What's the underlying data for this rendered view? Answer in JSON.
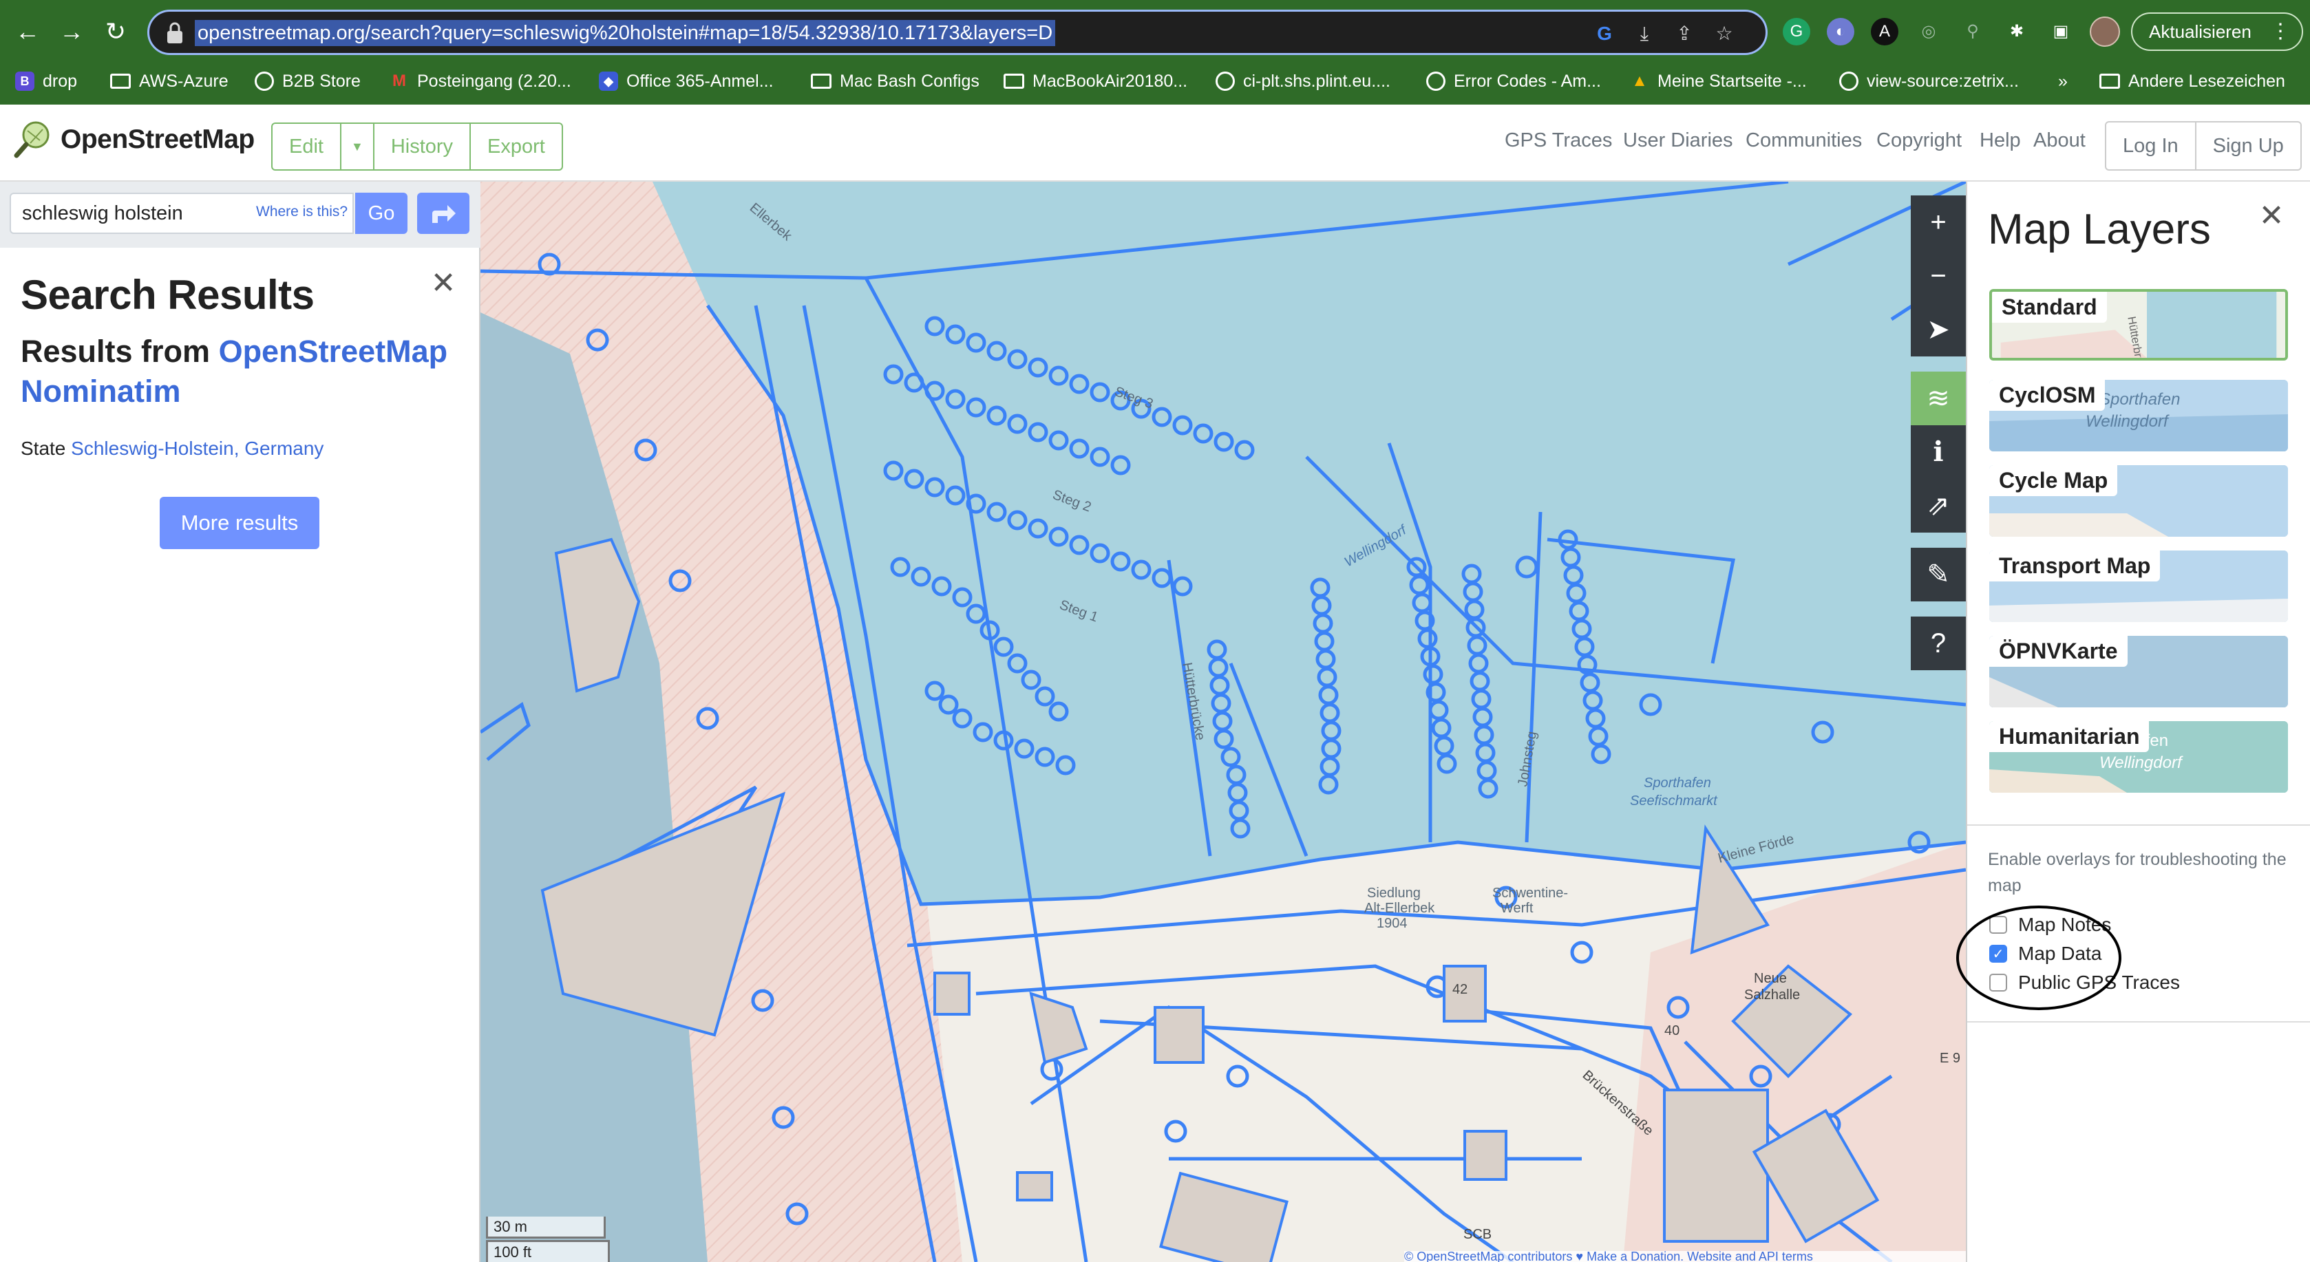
{
  "browser": {
    "url": "openstreetmap.org/search?query=schleswig%20holstein#map=18/54.32938/10.17173&layers=D",
    "update_label": "Aktualisieren",
    "bookmarks": [
      {
        "label": "drop"
      },
      {
        "label": "AWS-Azure"
      },
      {
        "label": "B2B Store"
      },
      {
        "label": "Posteingang (2.20..."
      },
      {
        "label": "Office 365-Anmel..."
      },
      {
        "label": "Mac Bash Configs"
      },
      {
        "label": "MacBookAir20180..."
      },
      {
        "label": "ci-plt.shs.plint.eu...."
      },
      {
        "label": "Error Codes - Am..."
      },
      {
        "label": "Meine Startseite -..."
      },
      {
        "label": "view-source:zetrix..."
      },
      {
        "label": "Andere Lesezeichen"
      }
    ],
    "overflow_label": "»"
  },
  "header": {
    "brand": "OpenStreetMap",
    "edit_label": "Edit",
    "history_label": "History",
    "export_label": "Export",
    "nav": [
      "GPS Traces",
      "User Diaries",
      "Communities",
      "Copyright",
      "Help",
      "About"
    ],
    "login_label": "Log In",
    "signup_label": "Sign Up"
  },
  "search": {
    "value": "schleswig holstein",
    "where_label": "Where is this?",
    "go_label": "Go"
  },
  "results": {
    "title": "Search Results",
    "from_prefix": "Results from ",
    "from_link": "OpenStreetMap Nominatim",
    "state_prefix": "State ",
    "state_link": "Schleswig-Holstein, Germany",
    "more_label": "More results"
  },
  "map": {
    "labels": {
      "steg3": "Steg 3",
      "steg2": "Steg 2",
      "steg1": "Steg 1",
      "wellingdorf": "Wellingdorf",
      "sporthafen": "Sporthafen",
      "seefisch": "Seefischmarkt",
      "hutterbrucke": "Hütterbrücke",
      "siedlung": "Siedlung",
      "alt": "Alt-Ellerbek",
      "jahr": "1904",
      "schwentine": "Schwentine-",
      "werft": "Werft",
      "neue": "Neue",
      "salzhalle": "Salzhalle",
      "brueckenstrasse": "Brückenstraße",
      "scb": "SCB",
      "num42": "42",
      "num40": "40",
      "e9": "E 9",
      "ellerbek": "Ellerbek",
      "johnsteig": "Johnsteg",
      "klein": "Kleine Förde"
    },
    "scale_metric": "30 m",
    "scale_imperial": "100 ft",
    "attribution": "© OpenStreetMap contributors ♥ Make a Donation. Website and API terms"
  },
  "layers": {
    "title": "Map Layers",
    "items": [
      {
        "label": "Standard",
        "selected": true
      },
      {
        "label": "CyclOSM",
        "selected": false
      },
      {
        "label": "Cycle Map",
        "selected": false
      },
      {
        "label": "Transport Map",
        "selected": false
      },
      {
        "label": "ÖPNVKarte",
        "selected": false
      },
      {
        "label": "Humanitarian",
        "selected": false
      }
    ],
    "thumb_labels": {
      "standard": "Hütterbrück",
      "cyclosm1": "Sporthafen",
      "cyclosm2": "Wellingdorf",
      "hum1": "hafen",
      "hum2": "Wellingdorf"
    },
    "overlay_intro": "Enable overlays for troubleshooting the map",
    "overlays": [
      {
        "label": "Map Notes",
        "checked": false
      },
      {
        "label": "Map Data",
        "checked": true
      },
      {
        "label": "Public GPS Traces",
        "checked": false
      }
    ]
  },
  "colors": {
    "brand_green": "#7ebc6f",
    "button_blue": "#7092ff",
    "water": "#aad3df",
    "data_blue": "#3b82f6"
  }
}
